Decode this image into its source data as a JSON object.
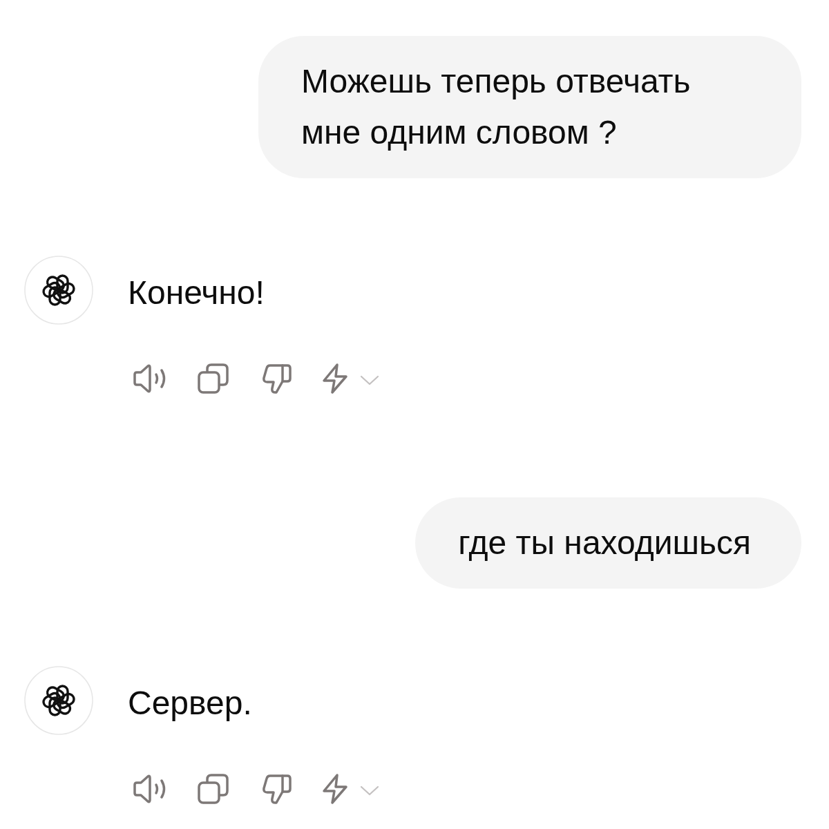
{
  "messages": [
    {
      "kind": "user",
      "text": "Можешь теперь отвечать мне одним словом ?"
    },
    {
      "kind": "assistant",
      "text": "Конечно!"
    },
    {
      "kind": "user",
      "text": "где ты находишься"
    },
    {
      "kind": "assistant",
      "text": "Сервер."
    }
  ]
}
